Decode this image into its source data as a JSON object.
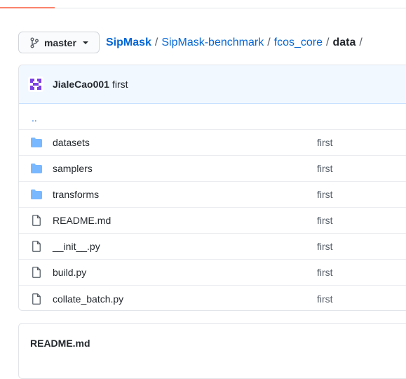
{
  "branch": {
    "name": "master",
    "icon": "git-branch-icon"
  },
  "breadcrumb": {
    "repo": "SipMask",
    "parts": [
      "SipMask-benchmark",
      "fcos_core"
    ],
    "current": "data",
    "separator": "/"
  },
  "commit": {
    "author": "JialeCao001",
    "message": "first"
  },
  "parent_dir": "..",
  "files": [
    {
      "name": "datasets",
      "type": "dir",
      "message": "first"
    },
    {
      "name": "samplers",
      "type": "dir",
      "message": "first"
    },
    {
      "name": "transforms",
      "type": "dir",
      "message": "first"
    },
    {
      "name": "README.md",
      "type": "file",
      "message": "first"
    },
    {
      "name": "__init__.py",
      "type": "file",
      "message": "first"
    },
    {
      "name": "build.py",
      "type": "file",
      "message": "first"
    },
    {
      "name": "collate_batch.py",
      "type": "file",
      "message": "first"
    }
  ],
  "readme": {
    "title": "README.md"
  },
  "colors": {
    "link": "#0366d6",
    "folder": "#79b8ff",
    "commit_bg": "#f1f8ff",
    "tab_accent": "#f9826c"
  }
}
